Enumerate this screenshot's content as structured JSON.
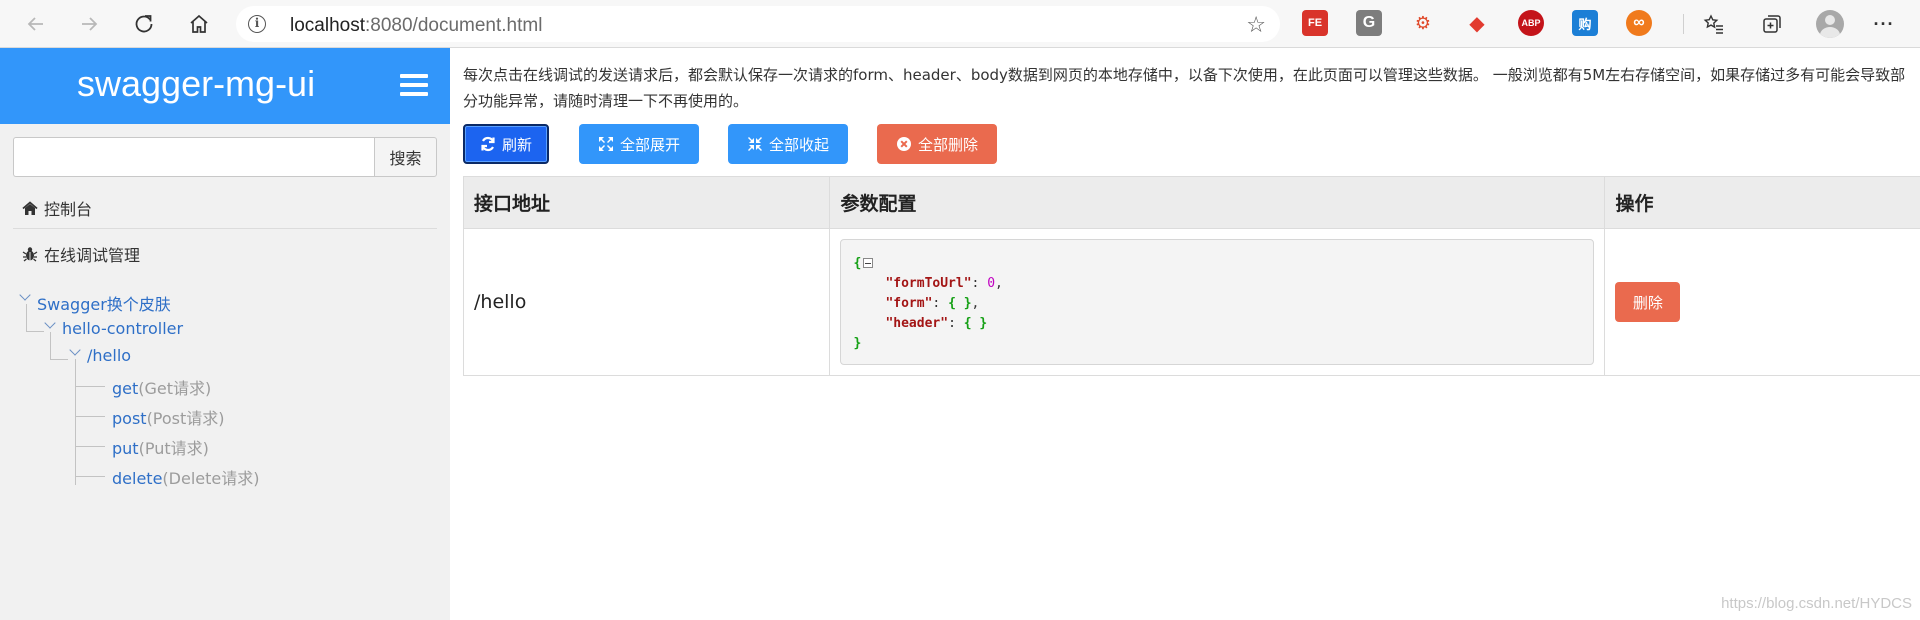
{
  "browser": {
    "address": {
      "host": "localhost",
      "rest": ":8080/document.html"
    },
    "info_icon_char": "i",
    "back_char": "←",
    "forward_char": "→",
    "refresh_char": "↻",
    "star_char": "☆",
    "more_char": "···",
    "extensions": [
      {
        "name": "fe-helper-extension",
        "label": "FE",
        "color": "#d9342b"
      },
      {
        "name": "grammarly-extension",
        "label": "G",
        "color": "#7d7d7d"
      },
      {
        "name": "network-extension",
        "label": "⚙",
        "color": "#e04a2b"
      },
      {
        "name": "cube-extension",
        "label": "◆",
        "color": "#e23b2f"
      },
      {
        "name": "adblock-plus-extension",
        "label": "ABP",
        "color": "#c4141a"
      },
      {
        "name": "translate-extension",
        "label": "购",
        "color": "#1c7fd6"
      },
      {
        "name": "infinity-extension",
        "label": "∞",
        "color": "#f07a1c"
      }
    ]
  },
  "sidebar": {
    "brand": "swagger-mg-ui",
    "search_button": "搜索",
    "search_value": "",
    "console_label": "控制台",
    "debug_manage_label": "在线调试管理",
    "tree": {
      "root": "Swagger换个皮肤",
      "controller": "hello-controller",
      "path": "/hello",
      "methods": [
        {
          "method": "get",
          "hint": "(Get请求)"
        },
        {
          "method": "post",
          "hint": "(Post请求)"
        },
        {
          "method": "put",
          "hint": "(Put请求)"
        },
        {
          "method": "delete",
          "hint": "(Delete请求)"
        }
      ]
    }
  },
  "main": {
    "description": "每次点击在线调试的发送请求后，都会默认保存一次请求的form、header、body数据到网页的本地存储中，以备下次使用，在此页面可以管理这些数据。 一般浏览都有5M左右存储空间，如果存储过多有可能会导致部分功能异常，请随时清理一下不再使用的。",
    "buttons": {
      "refresh": "刷新",
      "expand_all": "全部展开",
      "collapse_all": "全部收起",
      "delete_all": "全部删除"
    },
    "table": {
      "headers": [
        "接口地址",
        "参数配置",
        "操作"
      ],
      "rows": [
        {
          "url": "/hello",
          "json": {
            "open": "{",
            "close": "}",
            "lines": [
              {
                "key": "\"formToUrl\"",
                "sep": ": ",
                "value": "0",
                "tail": ","
              },
              {
                "key": "\"form\"",
                "sep": ": ",
                "value": "{ }",
                "tail": ","
              },
              {
                "key": "\"header\"",
                "sep": ": ",
                "value": "{ }",
                "tail": ""
              }
            ]
          },
          "action": "删除"
        }
      ]
    }
  },
  "watermark": "https://blog.csdn.net/HYDCS"
}
